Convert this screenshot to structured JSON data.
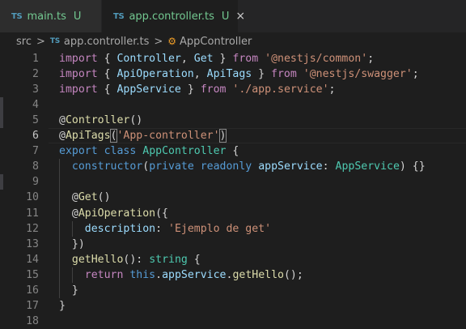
{
  "tabs": [
    {
      "icon": "TS",
      "name": "main.ts",
      "status": "U",
      "active": false
    },
    {
      "icon": "TS",
      "name": "app.controller.ts",
      "status": "U",
      "active": true,
      "close": "×"
    }
  ],
  "breadcrumb": {
    "folder": "src",
    "file_icon": "TS",
    "file": "app.controller.ts",
    "symbol": "AppController",
    "separator": ">"
  },
  "editor": {
    "active_line": 6,
    "lines": [
      {
        "n": "1",
        "tokens": [
          [
            "kw",
            "import"
          ],
          [
            "pl",
            " { "
          ],
          [
            "id",
            "Controller"
          ],
          [
            "pl",
            ", "
          ],
          [
            "id",
            "Get"
          ],
          [
            "pl",
            " } "
          ],
          [
            "kw",
            "from"
          ],
          [
            "pl",
            " "
          ],
          [
            "st",
            "'@nestjs/common'"
          ],
          [
            "pl",
            ";"
          ]
        ]
      },
      {
        "n": "2",
        "tokens": [
          [
            "kw",
            "import"
          ],
          [
            "pl",
            " { "
          ],
          [
            "id",
            "ApiOperation"
          ],
          [
            "pl",
            ", "
          ],
          [
            "id",
            "ApiTags"
          ],
          [
            "pl",
            " } "
          ],
          [
            "kw",
            "from"
          ],
          [
            "pl",
            " "
          ],
          [
            "st",
            "'@nestjs/swagger'"
          ],
          [
            "pl",
            ";"
          ]
        ]
      },
      {
        "n": "3",
        "tokens": [
          [
            "kw",
            "import"
          ],
          [
            "pl",
            " { "
          ],
          [
            "id",
            "AppService"
          ],
          [
            "pl",
            " } "
          ],
          [
            "kw",
            "from"
          ],
          [
            "pl",
            " "
          ],
          [
            "st",
            "'./app.service'"
          ],
          [
            "pl",
            ";"
          ]
        ]
      },
      {
        "n": "4",
        "tokens": []
      },
      {
        "n": "5",
        "tokens": [
          [
            "pl",
            "@"
          ],
          [
            "fn",
            "Controller"
          ],
          [
            "pl",
            "()"
          ]
        ]
      },
      {
        "n": "6",
        "tokens": [
          [
            "pl",
            "@"
          ],
          [
            "fn",
            "ApiTags"
          ],
          [
            "box",
            "("
          ],
          [
            "st",
            "'App-controller'"
          ],
          [
            "box",
            ")"
          ]
        ]
      },
      {
        "n": "7",
        "tokens": [
          [
            "kwb",
            "export"
          ],
          [
            "pl",
            " "
          ],
          [
            "kwb",
            "class"
          ],
          [
            "pl",
            " "
          ],
          [
            "ty",
            "AppController"
          ],
          [
            "pl",
            " {"
          ]
        ]
      },
      {
        "n": "8",
        "tokens": [
          [
            "pl",
            "  "
          ],
          [
            "kwb",
            "constructor"
          ],
          [
            "pl",
            "("
          ],
          [
            "kwb",
            "private"
          ],
          [
            "pl",
            " "
          ],
          [
            "kwb",
            "readonly"
          ],
          [
            "pl",
            " "
          ],
          [
            "id",
            "appService"
          ],
          [
            "pl",
            ": "
          ],
          [
            "ty",
            "AppService"
          ],
          [
            "pl",
            ") {}"
          ]
        ]
      },
      {
        "n": "9",
        "tokens": []
      },
      {
        "n": "10",
        "tokens": [
          [
            "pl",
            "  @"
          ],
          [
            "fn",
            "Get"
          ],
          [
            "pl",
            "()"
          ]
        ]
      },
      {
        "n": "11",
        "tokens": [
          [
            "pl",
            "  @"
          ],
          [
            "fn",
            "ApiOperation"
          ],
          [
            "pl",
            "({"
          ]
        ]
      },
      {
        "n": "12",
        "tokens": [
          [
            "pl",
            "    "
          ],
          [
            "id",
            "description"
          ],
          [
            "pl",
            ": "
          ],
          [
            "st",
            "'Ejemplo de get'"
          ]
        ]
      },
      {
        "n": "13",
        "tokens": [
          [
            "pl",
            "  })"
          ]
        ]
      },
      {
        "n": "14",
        "tokens": [
          [
            "pl",
            "  "
          ],
          [
            "fn",
            "getHello"
          ],
          [
            "pl",
            "(): "
          ],
          [
            "ty",
            "string"
          ],
          [
            "pl",
            " {"
          ]
        ]
      },
      {
        "n": "15",
        "tokens": [
          [
            "pl",
            "    "
          ],
          [
            "kw",
            "return"
          ],
          [
            "pl",
            " "
          ],
          [
            "kwb",
            "this"
          ],
          [
            "pl",
            "."
          ],
          [
            "id",
            "appService"
          ],
          [
            "pl",
            "."
          ],
          [
            "fn",
            "getHello"
          ],
          [
            "pl",
            "();"
          ]
        ]
      },
      {
        "n": "16",
        "tokens": [
          [
            "pl",
            "  }"
          ]
        ]
      },
      {
        "n": "17",
        "tokens": [
          [
            "pl",
            "}"
          ]
        ]
      },
      {
        "n": "18",
        "tokens": []
      }
    ]
  }
}
